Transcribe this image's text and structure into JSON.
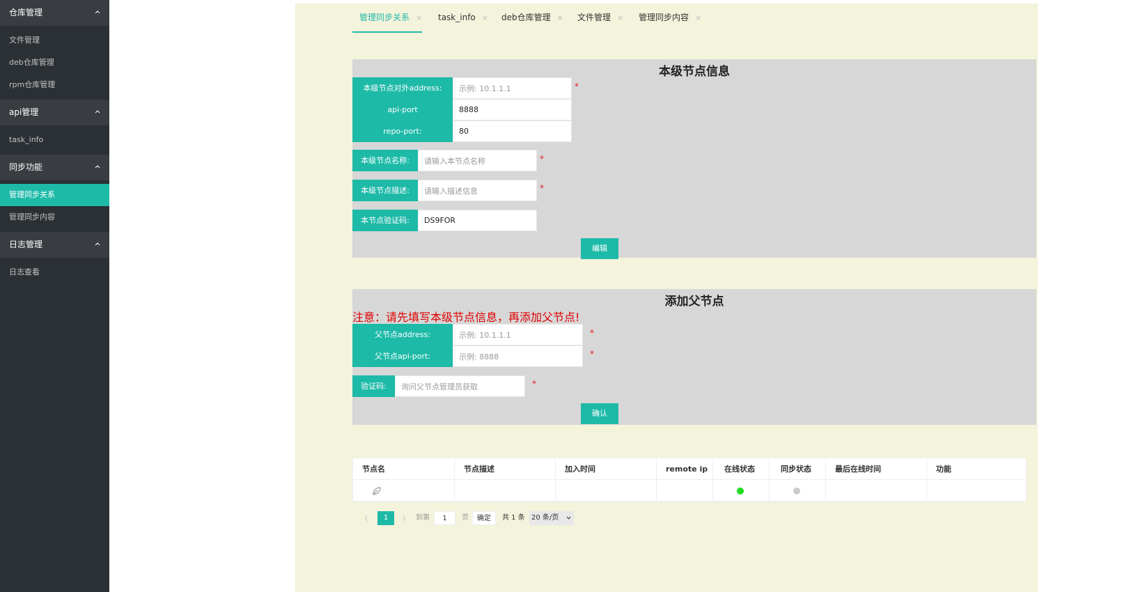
{
  "sidebar": {
    "groups": [
      {
        "title": "仓库管理",
        "items": [
          "文件管理",
          "deb仓库管理",
          "rpm仓库管理"
        ]
      },
      {
        "title": "api管理",
        "items": [
          "task_info"
        ]
      },
      {
        "title": "同步功能",
        "items": [
          "管理同步关系",
          "管理同步内容"
        ]
      },
      {
        "title": "日志管理",
        "items": [
          "日志查看"
        ]
      }
    ]
  },
  "tabs": [
    {
      "label": "管理同步关系",
      "close": "×"
    },
    {
      "label": "task_info",
      "close": "×"
    },
    {
      "label": "deb仓库管理",
      "close": "×"
    },
    {
      "label": "文件管理",
      "close": "×"
    },
    {
      "label": "管理同步内容",
      "close": "×"
    }
  ],
  "local_node": {
    "title": "本级节点信息",
    "address_label": "本级节点对外address:",
    "address_placeholder": "示例: 10.1.1.1",
    "api_port_label": "api-port",
    "api_port_value": "8888",
    "repo_port_label": "repo-port:",
    "repo_port_value": "80",
    "name_label": "本级节点名称:",
    "name_placeholder": "请输入本节点名称",
    "desc_label": "本级节点描述:",
    "desc_placeholder": "请输入描述信息",
    "code_label": "本节点验证码:",
    "code_value": "DS9FOR",
    "required_mark": "*",
    "edit_button": "编辑"
  },
  "parent_node": {
    "title": "添加父节点",
    "warning": "注意：请先填写本级节点信息，再添加父节点!",
    "address_label": "父节点address:",
    "address_placeholder": "示例: 10.1.1.1",
    "api_port_label": "父节点api-port:",
    "api_port_placeholder": "示例: 8888",
    "code_label": "验证码:",
    "code_placeholder": "询问父节点管理员获取",
    "required_mark": "*",
    "confirm_button": "确认"
  },
  "table": {
    "columns": [
      "节点名",
      "节点描述",
      "加入时间",
      "remote ip",
      "在线状态",
      "同步状态",
      "最后在线时间",
      "功能"
    ],
    "row": {
      "online_color": "#22dd22",
      "sync_color": "#cccccc"
    }
  },
  "pagination": {
    "current_page": "1",
    "goto_label": "到第",
    "goto_value": "1",
    "page_unit": "页",
    "confirm": "确定",
    "total": "共 1 条",
    "page_size": "20 条/页"
  }
}
